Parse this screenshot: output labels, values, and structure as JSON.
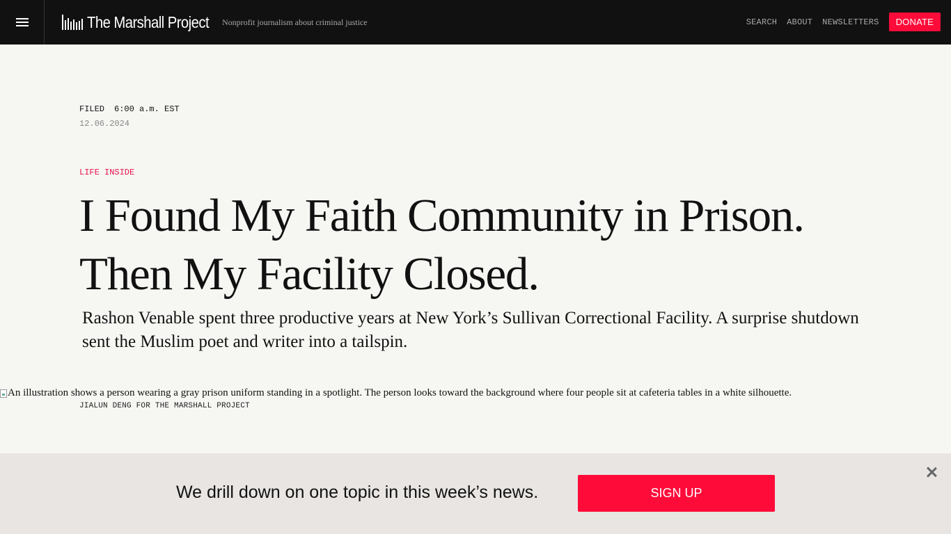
{
  "header": {
    "brand_name": "The Marshall Project",
    "tagline": "Nonprofit journalism about criminal justice",
    "nav": {
      "search": "SEARCH",
      "about": "ABOUT",
      "newsletters": "NEWSLETTERS",
      "donate": "DONATE"
    }
  },
  "article": {
    "filed_label": "FILED",
    "filed_time": "6:00 a.m. EST",
    "filed_date": "12.06.2024",
    "kicker": "LIFE INSIDE",
    "headline": "I Found My Faith Community in Prison. Then My Facility Closed.",
    "dek": "Rashon Venable spent three productive years at New York’s Sullivan Correctional Facility. A surprise shutdown sent the Muslim poet and writer into a tailspin.",
    "image_alt": "An illustration shows a person wearing a gray prison uniform standing in a spotlight. The person looks toward the background where four people sit at cafeteria tables in a white silhouette.",
    "image_credit": "JIALUN DENG FOR THE MARSHALL PROJECT"
  },
  "banner": {
    "text": "We drill down on one topic in this week’s news.",
    "signup_label": "SIGN UP"
  },
  "icons": {
    "menu": "hamburger-menu-icon",
    "logo": "bar-chart-logo-icon",
    "close": "close-icon",
    "broken_image": "broken-image-icon"
  },
  "colors": {
    "accent": "#ff0b3a",
    "kicker": "#e8124a",
    "header_bg": "#111111",
    "page_bg": "#f6f6f3",
    "banner_bg": "#e8e5e2"
  }
}
